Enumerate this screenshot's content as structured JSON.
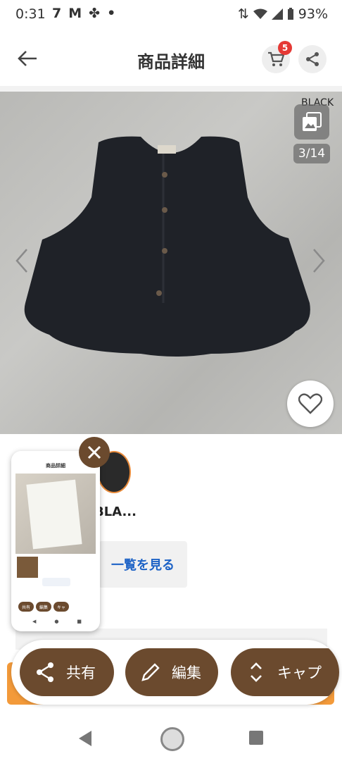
{
  "status": {
    "time": "0:31",
    "notif_icons": [
      "7",
      "M",
      "✤",
      "•"
    ],
    "battery": "93%"
  },
  "header": {
    "title": "商品詳細",
    "cart_count": "5"
  },
  "product": {
    "color_label": "BLACK",
    "image_counter": "3/14",
    "title_snippet": "BLA...",
    "list_link": "一覧を見る"
  },
  "preview": {
    "title": "商品詳細",
    "pills": [
      "共有",
      "編集",
      "キャ"
    ]
  },
  "actions": {
    "share": "共有",
    "edit": "編集",
    "capture": "キャプ"
  },
  "colors": {
    "accent_brown": "#6b4a2e",
    "badge_red": "#e53935",
    "link_blue": "#1e63c6",
    "orange": "#f39a3a"
  }
}
